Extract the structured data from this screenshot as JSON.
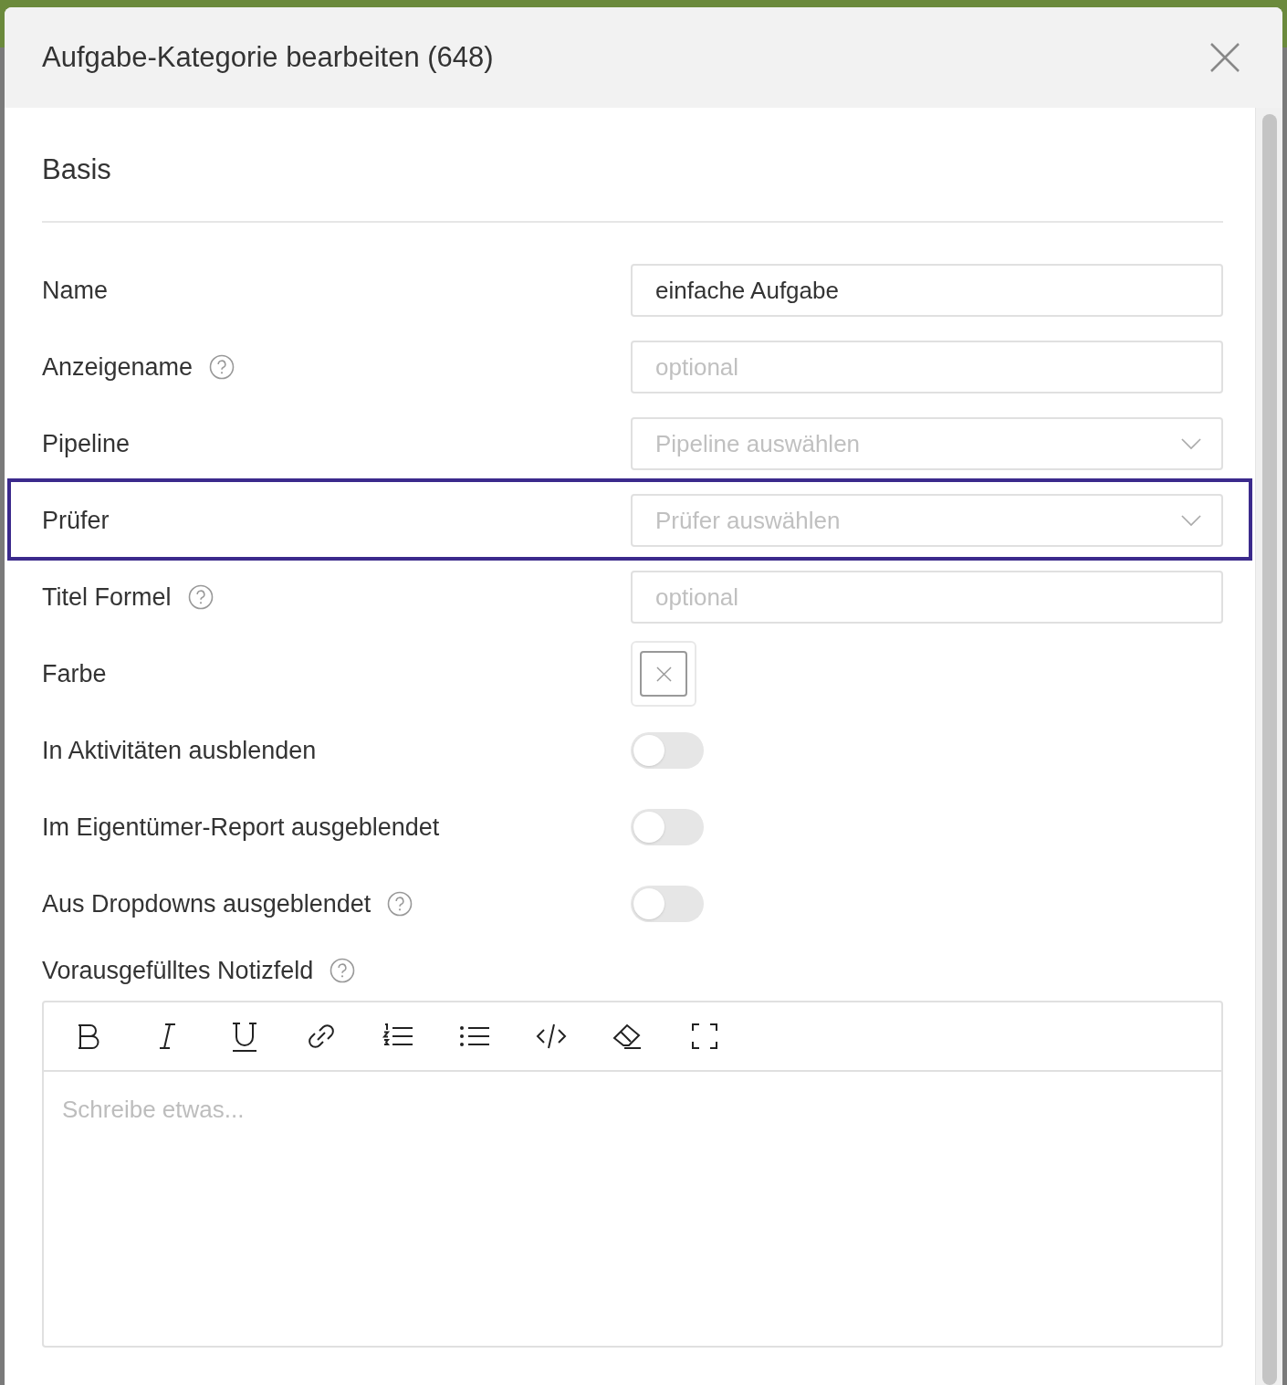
{
  "dialog": {
    "title": "Aufgabe-Kategorie bearbeiten (648)"
  },
  "section": {
    "title": "Basis"
  },
  "fields": [
    {
      "kind": "text",
      "label": "Name",
      "help": false,
      "value": "einfache Aufgabe",
      "highlighted": false
    },
    {
      "kind": "text",
      "label": "Anzeigename",
      "help": true,
      "placeholder": "optional",
      "highlighted": false
    },
    {
      "kind": "select",
      "label": "Pipeline",
      "help": false,
      "placeholder": "Pipeline auswählen",
      "highlighted": false
    },
    {
      "kind": "select",
      "label": "Prüfer",
      "help": false,
      "placeholder": "Prüfer auswählen",
      "highlighted": true
    },
    {
      "kind": "text",
      "label": "Titel Formel",
      "help": true,
      "placeholder": "optional",
      "highlighted": false
    },
    {
      "kind": "color",
      "label": "Farbe",
      "help": false,
      "highlighted": false
    },
    {
      "kind": "toggle",
      "label": "In Aktivitäten ausblenden",
      "help": false,
      "on": false,
      "highlighted": false
    },
    {
      "kind": "toggle",
      "label": "Im Eigentümer-Report ausgeblendet",
      "help": false,
      "on": false,
      "highlighted": false
    },
    {
      "kind": "toggle",
      "label": "Aus Dropdowns ausgeblendet",
      "help": true,
      "on": false,
      "highlighted": false
    }
  ],
  "editor": {
    "label": "Vorausgefülltes Notizfeld",
    "help": true,
    "placeholder": "Schreibe etwas..."
  }
}
